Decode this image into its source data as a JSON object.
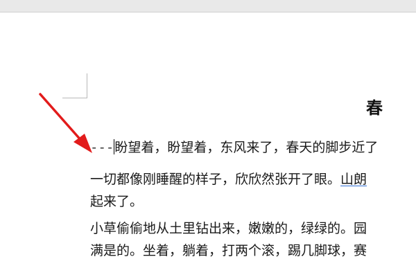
{
  "document": {
    "title": "春",
    "line1_prefix": "---",
    "line1_text": "盼望着，盼望着，东风来了，春天的脚步近了",
    "line2_text": "一切都像刚睡醒的样子，欣欣然张开了眼。",
    "line2_link": "山朗",
    "line3_text": "起来了。",
    "line4_text": "小草偷偷地从土里钻出来，嫩嫩的，绿绿的。园",
    "line5_text": "满是的。坐着，躺着，打两个滚，踢几脚球，赛"
  },
  "annotation": {
    "arrow_color": "#e21b1b",
    "description_icon": "red-arrow-icon"
  },
  "colors": {
    "link_underline": "#2f6fd6",
    "top_strip": "#e9e9e9",
    "text": "#1a1a1a"
  }
}
